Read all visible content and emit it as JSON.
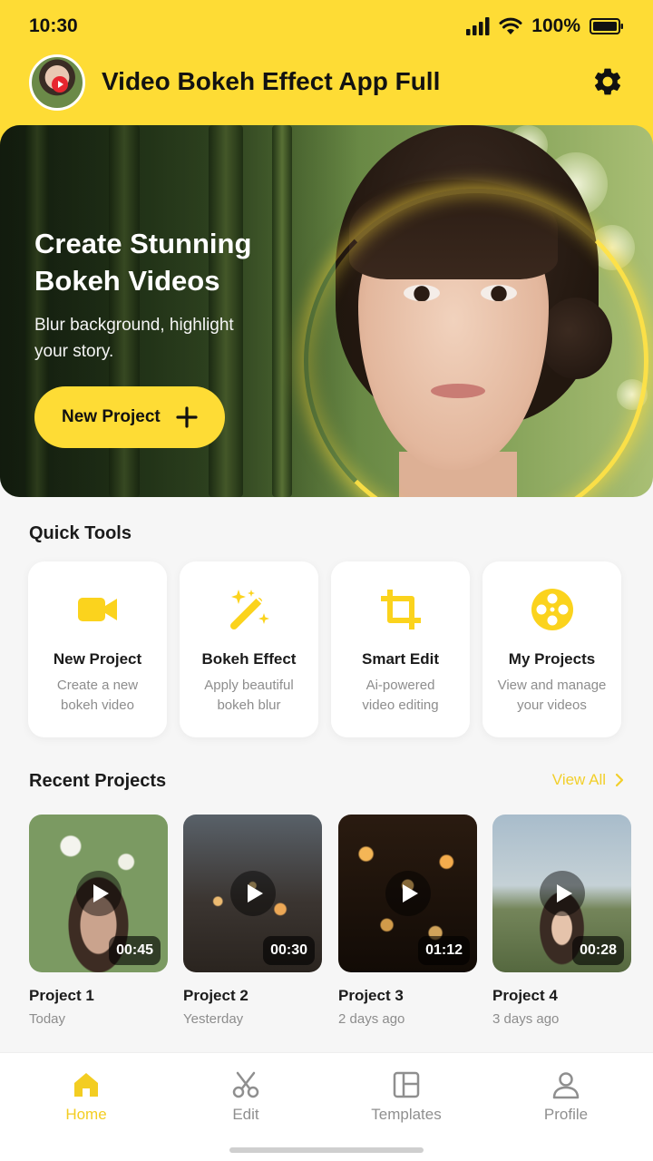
{
  "status": {
    "time": "10:30",
    "battery": "100%"
  },
  "header": {
    "title": "Video Bokeh Effect App Full",
    "avatar_icon": "avatar-play-icon",
    "settings_icon": "gear-icon"
  },
  "hero": {
    "title_line1": "Create Stunning",
    "title_line2": "Bokeh Videos",
    "subtitle_line1": "Blur background, highlight",
    "subtitle_line2": "your story.",
    "cta_label": "New Project"
  },
  "quick_tools": {
    "title": "Quick Tools",
    "items": [
      {
        "name": "New Project",
        "desc_line1": "Create a new",
        "desc_line2": "bokeh video",
        "icon": "video-camera-icon"
      },
      {
        "name": "Bokeh Effect",
        "desc_line1": "Apply beautiful",
        "desc_line2": "bokeh blur",
        "icon": "magic-wand-icon"
      },
      {
        "name": "Smart Edit",
        "desc_line1": "Ai-powered",
        "desc_line2": "video editing",
        "icon": "crop-icon"
      },
      {
        "name": "My Projects",
        "desc_line1": "View and manage",
        "desc_line2": "your videos",
        "icon": "film-reel-icon"
      }
    ]
  },
  "recent": {
    "title": "Recent Projects",
    "view_all": "View All",
    "items": [
      {
        "name": "Project 1",
        "date": "Today",
        "duration": "00:45"
      },
      {
        "name": "Project 2",
        "date": "Yesterday",
        "duration": "00:30"
      },
      {
        "name": "Project 3",
        "date": "2 days ago",
        "duration": "01:12"
      },
      {
        "name": "Project 4",
        "date": "3 days ago",
        "duration": "00:28"
      }
    ]
  },
  "nav": {
    "items": [
      {
        "label": "Home",
        "icon": "home-icon",
        "active": true
      },
      {
        "label": "Edit",
        "icon": "scissors-icon",
        "active": false
      },
      {
        "label": "Templates",
        "icon": "templates-icon",
        "active": false
      },
      {
        "label": "Profile",
        "icon": "person-icon",
        "active": false
      }
    ]
  },
  "colors": {
    "accent": "#fedc35",
    "accent_text": "#f2cf2a",
    "background": "#f6f6f6"
  }
}
